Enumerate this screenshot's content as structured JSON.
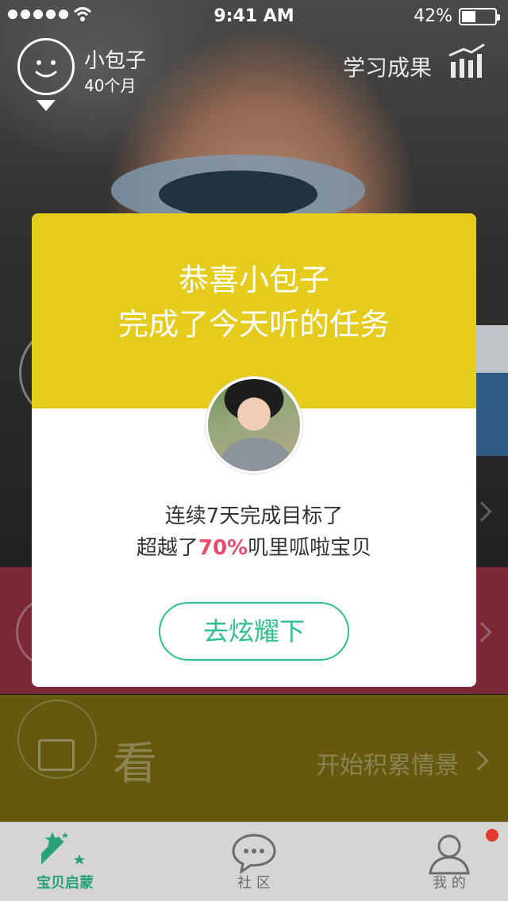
{
  "status_bar": {
    "time": "9:41 AM",
    "battery": "42%",
    "battery_level": 0.42,
    "signal_icon": "signal-dots-icon",
    "wifi_icon": "wifi-icon"
  },
  "header": {
    "child_name": "小包子",
    "child_age": "40个月",
    "results_label": "学习成果",
    "results_icon": "bar-chart-icon"
  },
  "sections": {
    "watch": {
      "label": "看",
      "action": "开始积累情景",
      "icon": "tv-icon"
    }
  },
  "modal": {
    "title_line1": "恭喜小包子",
    "title_line2": "完成了今天听的任务",
    "body_line1": "连续7天完成目标了",
    "body_line2_prefix": "超越了",
    "body_line2_highlight": "70%",
    "body_line2_suffix": "叽里呱啦宝贝",
    "share_button": "去炫耀下"
  },
  "tab_bar": {
    "tabs": [
      {
        "label": "宝贝启蒙",
        "icon": "magic-wand-icon",
        "active": true
      },
      {
        "label": "社 区",
        "icon": "chat-bubble-icon",
        "active": false
      },
      {
        "label": "我 的",
        "icon": "user-icon",
        "active": false,
        "badge": true
      }
    ]
  },
  "colors": {
    "modal_header": "#e5cb1c",
    "accent_green": "#2dc08a",
    "highlight_pink": "#e84c6f",
    "band_red": "#983043",
    "band_yellow": "#7b6d12"
  }
}
